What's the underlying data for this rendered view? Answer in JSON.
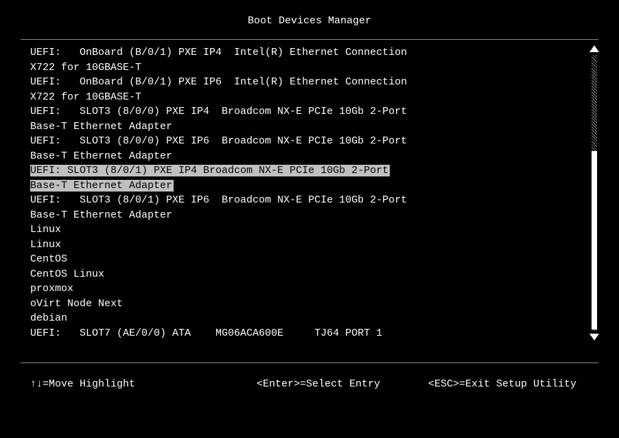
{
  "header": {
    "title": "Boot Devices Manager"
  },
  "boot_entries": [
    {
      "text": "UEFI:   OnBoard (B/0/1) PXE IP4  Intel(R) Ethernet Connection X722 for 10GBASE-T",
      "selected": false
    },
    {
      "text": "UEFI:   OnBoard (B/0/1) PXE IP6  Intel(R) Ethernet Connection X722 for 10GBASE-T",
      "selected": false
    },
    {
      "text": "UEFI:   SLOT3 (8/0/0) PXE IP4  Broadcom NX-E PCIe 10Gb 2-Port Base-T Ethernet Adapter",
      "selected": false
    },
    {
      "text": "UEFI:   SLOT3 (8/0/0) PXE IP6  Broadcom NX-E PCIe 10Gb 2-Port Base-T Ethernet Adapter",
      "selected": false
    },
    {
      "text": "UEFI:   SLOT3 (8/0/1) PXE IP4  Broadcom NX-E PCIe 10Gb 2-Port Base-T Ethernet Adapter",
      "selected": true,
      "line1": "UEFI:   SLOT3 (8/0/1) PXE IP4  Broadcom NX-E PCIe 10Gb 2-Port",
      "line2": "Base-T Ethernet Adapter"
    },
    {
      "text": "UEFI:   SLOT3 (8/0/1) PXE IP6  Broadcom NX-E PCIe 10Gb 2-Port Base-T Ethernet Adapter",
      "selected": false
    },
    {
      "text": "Linux",
      "selected": false
    },
    {
      "text": "Linux",
      "selected": false
    },
    {
      "text": "CentOS",
      "selected": false
    },
    {
      "text": "CentOS Linux",
      "selected": false
    },
    {
      "text": "proxmox",
      "selected": false
    },
    {
      "text": "oVirt Node Next",
      "selected": false
    },
    {
      "text": "debian",
      "selected": false
    },
    {
      "text": "UEFI:   SLOT7 (AE/0/0) ATA    MG06ACA600E     TJ64 PORT 1",
      "selected": false
    }
  ],
  "footer": {
    "move": "↑↓=Move Highlight",
    "select": "<Enter>=Select Entry",
    "exit": "<ESC>=Exit Setup Utility"
  }
}
